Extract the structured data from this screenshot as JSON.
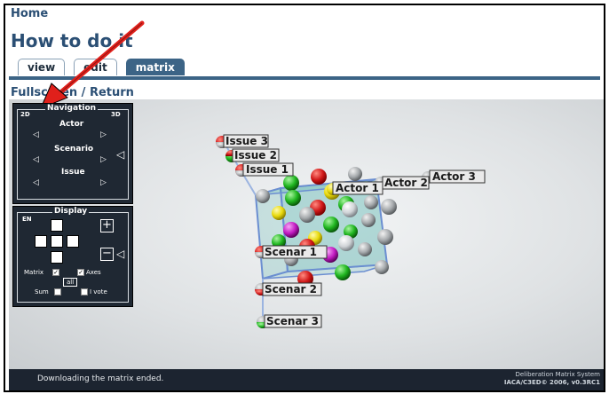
{
  "page": {
    "home": "Home",
    "title": "How to do it",
    "fullscreen_label": "Fullscreen / Return"
  },
  "tabs": [
    {
      "label": "view"
    },
    {
      "label": "edit"
    },
    {
      "label": "matrix",
      "active": true
    }
  ],
  "navigation": {
    "title": "Navigation",
    "mode_2d": "2D",
    "mode_3d": "3D",
    "rows": [
      {
        "label": "Actor"
      },
      {
        "label": "Scenario"
      },
      {
        "label": "Issue"
      }
    ]
  },
  "display": {
    "title": "Display",
    "lang": "EN",
    "zoom_in": "+",
    "zoom_out": "−",
    "matrix_label": "Matrix",
    "axes_label": "Axes",
    "all_label": "all",
    "sum_label": "Sum",
    "vote_label": "I vote",
    "matrix_checked": true,
    "axes_checked": true
  },
  "matrix": {
    "issues": [
      "Issue 3",
      "Issue 2",
      "Issue 1"
    ],
    "actors": [
      "Actor 1",
      "Actor 2",
      "Actor 3"
    ],
    "scenarios": [
      "Scenar 1",
      "Scenar 2",
      "Scenar 3"
    ]
  },
  "status": {
    "message": "Downloading the matrix ended.",
    "system_name": "Deliberation Matrix System",
    "copyright": "IACA/C3ED© 2006, v0.3RC1"
  },
  "colors": {
    "header_blue": "#2b4f74",
    "tab_active": "#3c6486",
    "panel_bg": "#1f2833",
    "arrow": "#e0201b"
  }
}
